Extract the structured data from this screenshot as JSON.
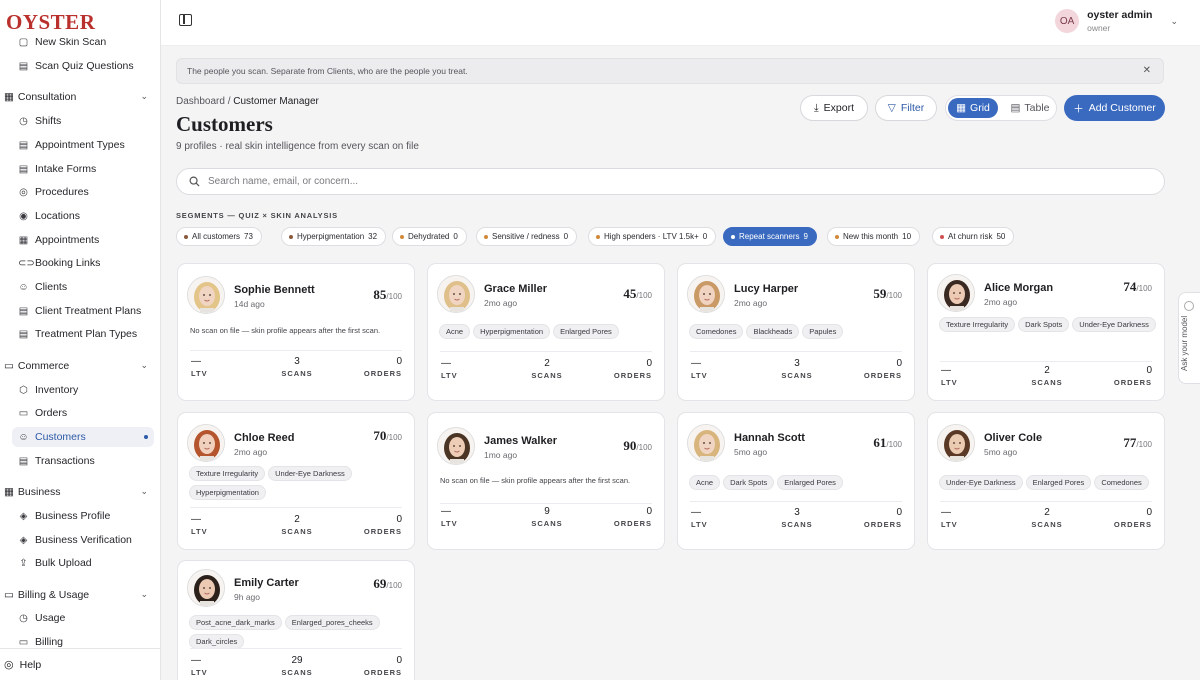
{
  "app": {
    "logo": "OYSTER"
  },
  "sidebar": {
    "items": [
      {
        "key": "new-skin-scan",
        "label": "New Skin Scan",
        "icon": "▢",
        "type": "item",
        "top": 0
      },
      {
        "key": "scan-quiz",
        "label": "Scan Quiz Questions",
        "icon": "▤",
        "type": "item"
      },
      {
        "key": "consultation",
        "label": "Consultation",
        "icon": "▦",
        "type": "section"
      },
      {
        "key": "shifts",
        "label": "Shifts",
        "icon": "◷",
        "type": "item"
      },
      {
        "key": "appointment-types",
        "label": "Appointment Types",
        "icon": "▤",
        "type": "item"
      },
      {
        "key": "intake-forms",
        "label": "Intake Forms",
        "icon": "▤",
        "type": "item"
      },
      {
        "key": "procedures",
        "label": "Procedures",
        "icon": "◎",
        "type": "item"
      },
      {
        "key": "locations",
        "label": "Locations",
        "icon": "◉",
        "type": "item"
      },
      {
        "key": "appointments",
        "label": "Appointments",
        "icon": "▦",
        "type": "item"
      },
      {
        "key": "booking-links",
        "label": "Booking Links",
        "icon": "⊂⊃",
        "type": "item"
      },
      {
        "key": "clients",
        "label": "Clients",
        "icon": "☺",
        "type": "item"
      },
      {
        "key": "client-treatment-plans",
        "label": "Client Treatment Plans",
        "icon": "▤",
        "type": "item"
      },
      {
        "key": "treatment-plan-types",
        "label": "Treatment Plan Types",
        "icon": "▤",
        "type": "item"
      },
      {
        "key": "commerce",
        "label": "Commerce",
        "icon": "▭",
        "type": "section"
      },
      {
        "key": "inventory",
        "label": "Inventory",
        "icon": "⬡",
        "type": "item"
      },
      {
        "key": "orders",
        "label": "Orders",
        "icon": "▭",
        "type": "item"
      },
      {
        "key": "customers",
        "label": "Customers",
        "icon": "☺",
        "type": "item",
        "active": true
      },
      {
        "key": "transactions",
        "label": "Transactions",
        "icon": "▤",
        "type": "item"
      },
      {
        "key": "business",
        "label": "Business",
        "icon": "▦",
        "type": "section"
      },
      {
        "key": "business-profile",
        "label": "Business Profile",
        "icon": "◈",
        "type": "item"
      },
      {
        "key": "business-verification",
        "label": "Business Verification",
        "icon": "◈",
        "type": "item"
      },
      {
        "key": "bulk-upload",
        "label": "Bulk Upload",
        "icon": "⇪",
        "type": "item"
      },
      {
        "key": "billing-usage",
        "label": "Billing & Usage",
        "icon": "▭",
        "type": "section"
      },
      {
        "key": "usage",
        "label": "Usage",
        "icon": "◷",
        "type": "item"
      },
      {
        "key": "billing",
        "label": "Billing",
        "icon": "▭",
        "type": "item"
      }
    ],
    "help_label": "Help"
  },
  "user": {
    "initials": "OA",
    "name": "oyster admin",
    "role": "owner"
  },
  "banner": {
    "text": "The people you scan. Separate from Clients, who are the people you treat."
  },
  "breadcrumb": {
    "root": "Dashboard",
    "sep": " / ",
    "current": "Customer Manager"
  },
  "page": {
    "title": "Customers",
    "subtitle": "9 profiles · real skin intelligence from every scan on file"
  },
  "toolbar": {
    "export": "Export",
    "filter": "Filter",
    "grid": "Grid",
    "table": "Table",
    "add": "Add Customer"
  },
  "search": {
    "placeholder": "Search name, email, or concern..."
  },
  "segments": {
    "label": "SEGMENTS — QUIZ × SKIN ANALYSIS",
    "chips": [
      {
        "label": "All customers",
        "count": "73",
        "dot": "#8a5a3c"
      },
      {
        "label": "Hyperpigmentation",
        "count": "32",
        "dot": "#8a5a3c"
      },
      {
        "label": "Dehydrated",
        "count": "0",
        "dot": "#d08a3a"
      },
      {
        "label": "Sensitive / redness",
        "count": "0",
        "dot": "#d08a3a"
      },
      {
        "label": "High spenders · LTV 1.5k+",
        "count": "0",
        "dot": "#d08a3a"
      },
      {
        "label": "Repeat scanners",
        "count": "9",
        "dot": "#ffffff",
        "selected": true
      },
      {
        "label": "New this month",
        "count": "10",
        "dot": "#d08a3a"
      },
      {
        "label": "At churn risk",
        "count": "50",
        "dot": "#d05050"
      }
    ]
  },
  "customers": [
    {
      "name": "Sophie Bennett",
      "ago": "14d ago",
      "score": "85",
      "den": "/100",
      "tags": [],
      "note": "No scan on file — skin profile appears after the first scan.",
      "ltv": "—",
      "scans": "3",
      "orders": "0",
      "hair": "#e3c489",
      "skin": "#f1d5c3"
    },
    {
      "name": "Grace Miller",
      "ago": "2mo ago",
      "score": "45",
      "den": "/100",
      "tags": [
        "Acne",
        "Hyperpigmentation",
        "Enlarged Pores"
      ],
      "note": "",
      "ltv": "—",
      "scans": "2",
      "orders": "0",
      "hair": "#e0c08a",
      "skin": "#f1d5c3"
    },
    {
      "name": "Lucy Harper",
      "ago": "2mo ago",
      "score": "59",
      "den": "/100",
      "tags": [
        "Comedones",
        "Blackheads",
        "Papules"
      ],
      "note": "",
      "ltv": "—",
      "scans": "3",
      "orders": "0",
      "hair": "#c99a66",
      "skin": "#f0d3c0"
    },
    {
      "name": "Alice Morgan",
      "ago": "2mo ago",
      "score": "74",
      "den": "/100",
      "tags": [
        "Texture Irregularity",
        "Dark Spots",
        "Under-Eye Darkness"
      ],
      "note": "",
      "ltv": "—",
      "scans": "2",
      "orders": "0",
      "hair": "#3b2a22",
      "skin": "#eccab4"
    },
    {
      "name": "Chloe Reed",
      "ago": "2mo ago",
      "score": "70",
      "den": "/100",
      "tags": [
        "Texture Irregularity",
        "Under-Eye Darkness",
        "Hyperpigmentation"
      ],
      "note": "",
      "ltv": "—",
      "scans": "2",
      "orders": "0",
      "hair": "#b4552e",
      "skin": "#f1d1bd"
    },
    {
      "name": "James Walker",
      "ago": "1mo ago",
      "score": "90",
      "den": "/100",
      "tags": [],
      "note": "No scan on file — skin profile appears after the first scan.",
      "ltv": "—",
      "scans": "9",
      "orders": "0",
      "hair": "#4a3424",
      "skin": "#edcdb6"
    },
    {
      "name": "Hannah Scott",
      "ago": "5mo ago",
      "score": "61",
      "den": "/100",
      "tags": [
        "Acne",
        "Dark Spots",
        "Enlarged Pores"
      ],
      "note": "",
      "ltv": "—",
      "scans": "3",
      "orders": "0",
      "hair": "#d9b57e",
      "skin": "#f1d5c3"
    },
    {
      "name": "Oliver Cole",
      "ago": "5mo ago",
      "score": "77",
      "den": "/100",
      "tags": [
        "Under-Eye Darkness",
        "Enlarged Pores",
        "Comedones"
      ],
      "note": "",
      "ltv": "—",
      "scans": "2",
      "orders": "0",
      "hair": "#5a3a26",
      "skin": "#eccbb3"
    },
    {
      "name": "Emily Carter",
      "ago": "9h ago",
      "score": "69",
      "den": "/100",
      "tags": [
        "Post_acne_dark_marks",
        "Enlarged_pores_cheeks",
        "Dark_circles"
      ],
      "note": "",
      "ltv": "—",
      "scans": "29",
      "orders": "0",
      "hair": "#2c201b",
      "skin": "#ecc9b2"
    }
  ],
  "stats": {
    "ltv_label": "LTV",
    "scans_label": "SCANS",
    "orders_label": "ORDERS"
  },
  "ask": {
    "label": "Ask your model"
  }
}
